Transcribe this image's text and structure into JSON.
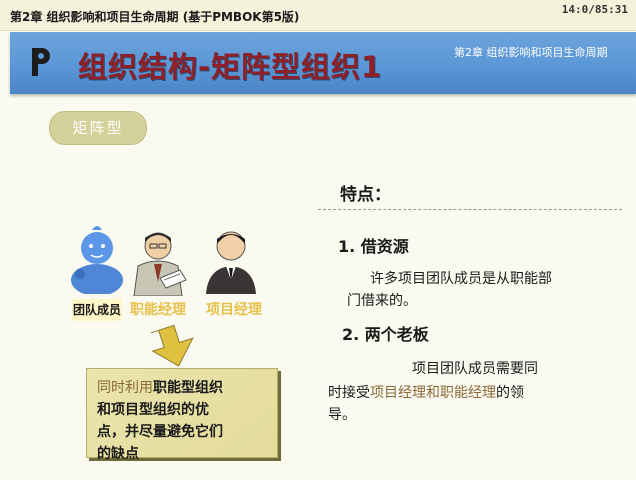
{
  "topbar": {
    "chapter": "第2章 组织影响和项目生命周期 (基于PMBOK第5版)",
    "clock": "14:0/85:31"
  },
  "banner": {
    "title": "组织结构-矩阵型组织1",
    "subtitle": "第2章  组织影响和项目生命周期",
    "color": "#5b97d6"
  },
  "pill": {
    "label": "矩阵型"
  },
  "figures": [
    {
      "label": "团队成员",
      "icon": "team-member-figure"
    },
    {
      "label": "职能经理",
      "icon": "functional-manager-figure"
    },
    {
      "label": "项目经理",
      "icon": "project-manager-figure"
    }
  ],
  "note": {
    "line1_dim": "同时利用",
    "line1": "职能型组织",
    "line2": "和项目型组织的优",
    "line3": "点，并尽量避免它们",
    "line4": "的缺点"
  },
  "features": {
    "heading": "特点：",
    "items": [
      {
        "title": "1. 借资源",
        "line1": "许多项目团队成员是从职能部",
        "line2": "门借来的。"
      },
      {
        "title": "2. 两个老板",
        "line1": "项目团队成员需要同",
        "line2_a": "时接受",
        "line2_hl": "项目经理和职能经理",
        "line2_b": "的领",
        "line3": "导。"
      }
    ]
  }
}
